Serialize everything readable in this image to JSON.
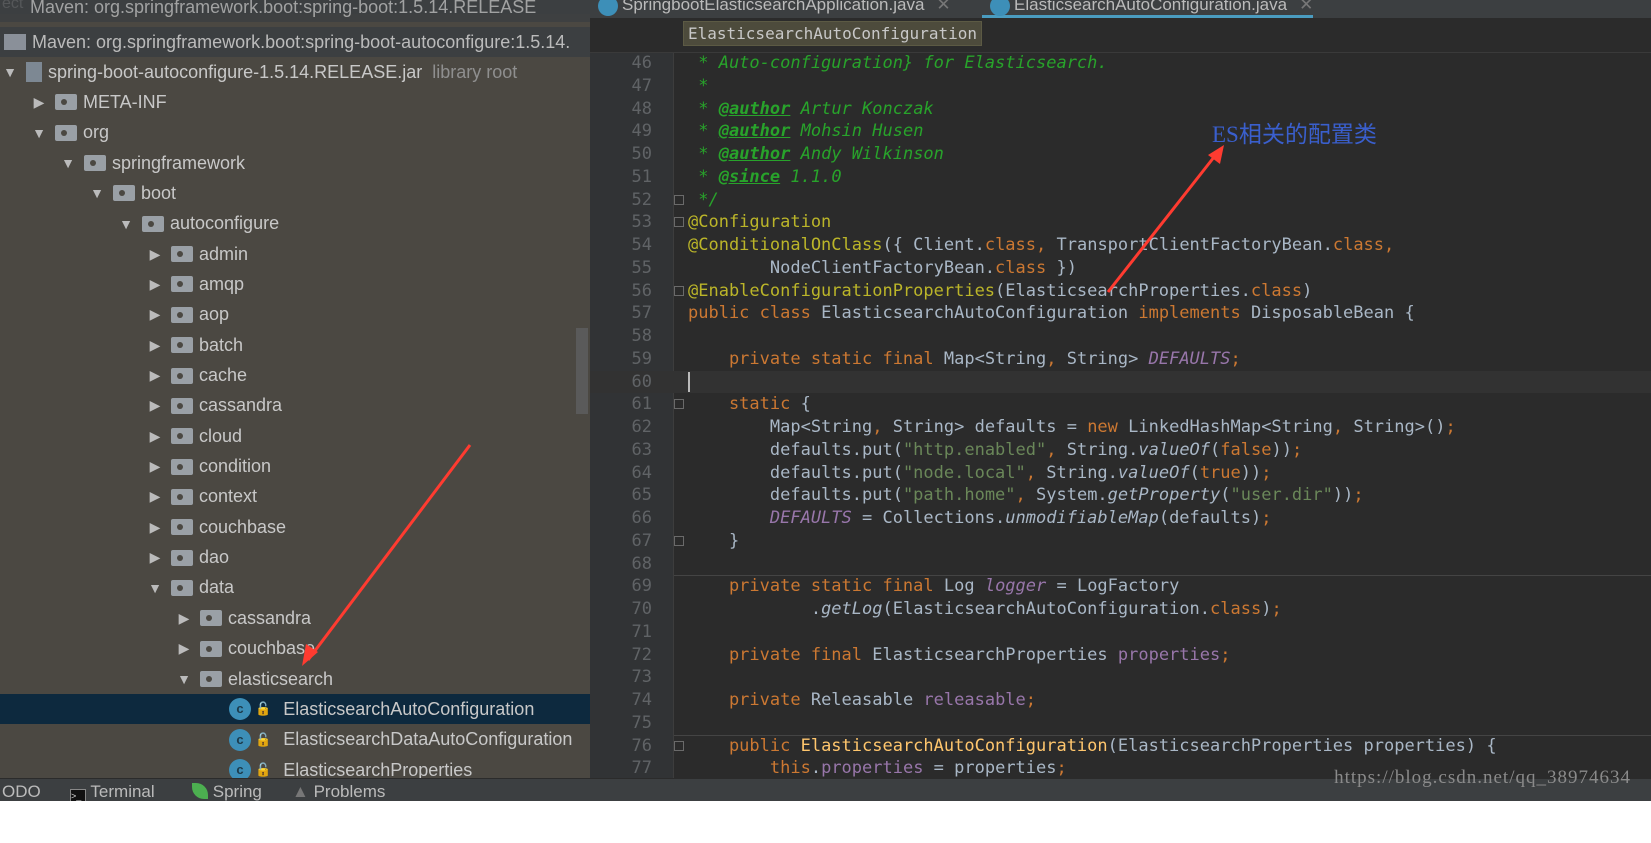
{
  "project_panel": {
    "header_label": "ect",
    "row_prev": "Maven: org.springframework.boot:spring-boot:1.5.14.RELEASE",
    "row_maven": "Maven: org.springframework.boot:spring-boot-autoconfigure:1.5.14.",
    "tree": [
      {
        "label": "spring-boot-autoconfigure-1.5.14.RELEASE.jar",
        "extra": "library root",
        "level": 0,
        "state": "open",
        "kind": "jar"
      },
      {
        "label": "META-INF",
        "level": 1,
        "state": "closed",
        "kind": "folder"
      },
      {
        "label": "org",
        "level": 1,
        "state": "open",
        "kind": "folder"
      },
      {
        "label": "springframework",
        "level": 2,
        "state": "open",
        "kind": "folder"
      },
      {
        "label": "boot",
        "level": 3,
        "state": "open",
        "kind": "folder"
      },
      {
        "label": "autoconfigure",
        "level": 4,
        "state": "open",
        "kind": "folder"
      },
      {
        "label": "admin",
        "level": 5,
        "state": "closed",
        "kind": "folder"
      },
      {
        "label": "amqp",
        "level": 5,
        "state": "closed",
        "kind": "folder"
      },
      {
        "label": "aop",
        "level": 5,
        "state": "closed",
        "kind": "folder"
      },
      {
        "label": "batch",
        "level": 5,
        "state": "closed",
        "kind": "folder"
      },
      {
        "label": "cache",
        "level": 5,
        "state": "closed",
        "kind": "folder"
      },
      {
        "label": "cassandra",
        "level": 5,
        "state": "closed",
        "kind": "folder"
      },
      {
        "label": "cloud",
        "level": 5,
        "state": "closed",
        "kind": "folder"
      },
      {
        "label": "condition",
        "level": 5,
        "state": "closed",
        "kind": "folder"
      },
      {
        "label": "context",
        "level": 5,
        "state": "closed",
        "kind": "folder"
      },
      {
        "label": "couchbase",
        "level": 5,
        "state": "closed",
        "kind": "folder"
      },
      {
        "label": "dao",
        "level": 5,
        "state": "closed",
        "kind": "folder"
      },
      {
        "label": "data",
        "level": 5,
        "state": "open",
        "kind": "folder"
      },
      {
        "label": "cassandra",
        "level": 6,
        "state": "closed",
        "kind": "folder"
      },
      {
        "label": "couchbase",
        "level": 6,
        "state": "closed",
        "kind": "folder"
      },
      {
        "label": "elasticsearch",
        "level": 6,
        "state": "open",
        "kind": "folder"
      },
      {
        "label": "ElasticsearchAutoConfiguration",
        "level": 7,
        "state": "leaf",
        "kind": "class",
        "selected": true
      },
      {
        "label": "ElasticsearchDataAutoConfiguration",
        "level": 7,
        "state": "leaf",
        "kind": "class"
      },
      {
        "label": "ElasticsearchProperties",
        "level": 7,
        "state": "leaf",
        "kind": "class"
      }
    ]
  },
  "tabs": [
    {
      "label": "SpringbootElasticsearchApplication.java",
      "active": false
    },
    {
      "label": "ElasticsearchAutoConfiguration.java",
      "active": true
    }
  ],
  "breadcrumb": "ElasticsearchAutoConfiguration",
  "code": [
    {
      "n": "46",
      "t": [
        [
          "cm",
          " * Auto-configuration} for Elasticsearch."
        ]
      ]
    },
    {
      "n": "47",
      "t": [
        [
          "cm",
          " *"
        ]
      ]
    },
    {
      "n": "48",
      "t": [
        [
          "cm",
          " * "
        ],
        [
          "tg",
          "@author"
        ],
        [
          "cm",
          " Artur Konczak"
        ]
      ]
    },
    {
      "n": "49",
      "t": [
        [
          "cm",
          " * "
        ],
        [
          "tg",
          "@author"
        ],
        [
          "cm",
          " Mohsin Husen"
        ]
      ]
    },
    {
      "n": "50",
      "t": [
        [
          "cm",
          " * "
        ],
        [
          "tg",
          "@author"
        ],
        [
          "cm",
          " Andy Wilkinson"
        ]
      ]
    },
    {
      "n": "51",
      "t": [
        [
          "cm",
          " * "
        ],
        [
          "tg",
          "@since"
        ],
        [
          "cm",
          " 1.1.0"
        ]
      ]
    },
    {
      "n": "52",
      "t": [
        [
          "cm",
          " */"
        ]
      ]
    },
    {
      "n": "53",
      "t": [
        [
          "a",
          "@Configuration"
        ]
      ]
    },
    {
      "n": "54",
      "t": [
        [
          "a",
          "@ConditionalOnClass"
        ],
        [
          "",
          "({ Client."
        ],
        [
          "k",
          "class"
        ],
        [
          "k",
          ", "
        ],
        [
          "",
          "TransportClientFactoryBean."
        ],
        [
          "k",
          "class"
        ],
        [
          "k",
          ","
        ]
      ]
    },
    {
      "n": "55",
      "t": [
        [
          "",
          "        NodeClientFactoryBean."
        ],
        [
          "k",
          "class"
        ],
        [
          "",
          " })"
        ]
      ]
    },
    {
      "n": "56",
      "t": [
        [
          "a",
          "@EnableConfigurationProperties"
        ],
        [
          "",
          "(ElasticsearchProperties."
        ],
        [
          "k",
          "class"
        ],
        [
          "",
          ")"
        ]
      ]
    },
    {
      "n": "57",
      "t": [
        [
          "k",
          "public class "
        ],
        [
          "",
          "ElasticsearchAutoConfiguration "
        ],
        [
          "k",
          "implements "
        ],
        [
          "",
          "DisposableBean {"
        ]
      ]
    },
    {
      "n": "58",
      "t": []
    },
    {
      "n": "59",
      "t": [
        [
          "k",
          "    private static final "
        ],
        [
          "",
          "Map<String"
        ],
        [
          "k",
          ", "
        ],
        [
          "",
          "String> "
        ],
        [
          "st",
          "DEFAULTS"
        ],
        [
          "k",
          ";"
        ]
      ]
    },
    {
      "n": "60",
      "t": []
    },
    {
      "n": "61",
      "t": [
        [
          "k",
          "    static "
        ],
        [
          "",
          "{"
        ]
      ]
    },
    {
      "n": "62",
      "t": [
        [
          "",
          "        Map<String"
        ],
        [
          "k",
          ", "
        ],
        [
          "",
          "String> defaults = "
        ],
        [
          "k",
          "new "
        ],
        [
          "",
          "LinkedHashMap<String"
        ],
        [
          "k",
          ", "
        ],
        [
          "",
          "String>()"
        ],
        [
          "k",
          ";"
        ]
      ]
    },
    {
      "n": "63",
      "t": [
        [
          "",
          "        defaults.put("
        ],
        [
          "s",
          "\"http.enabled\""
        ],
        [
          "k",
          ", "
        ],
        [
          "",
          "String."
        ],
        [
          "i",
          "valueOf"
        ],
        [
          "",
          "("
        ],
        [
          "k",
          "false"
        ],
        [
          "",
          "))"
        ],
        [
          "k",
          ";"
        ]
      ]
    },
    {
      "n": "64",
      "t": [
        [
          "",
          "        defaults.put("
        ],
        [
          "s",
          "\"node.local\""
        ],
        [
          "k",
          ", "
        ],
        [
          "",
          "String."
        ],
        [
          "i",
          "valueOf"
        ],
        [
          "",
          "("
        ],
        [
          "k",
          "true"
        ],
        [
          "",
          "))"
        ],
        [
          "k",
          ";"
        ]
      ]
    },
    {
      "n": "65",
      "t": [
        [
          "",
          "        defaults.put("
        ],
        [
          "s",
          "\"path.home\""
        ],
        [
          "k",
          ", "
        ],
        [
          "",
          "System."
        ],
        [
          "i",
          "getProperty"
        ],
        [
          "",
          "("
        ],
        [
          "s",
          "\"user.dir\""
        ],
        [
          "",
          "))"
        ],
        [
          "k",
          ";"
        ]
      ]
    },
    {
      "n": "66",
      "t": [
        [
          "st",
          "        DEFAULTS"
        ],
        [
          "",
          " = Collections."
        ],
        [
          "i",
          "unmodifiableMap"
        ],
        [
          "",
          "(defaults)"
        ],
        [
          "k",
          ";"
        ]
      ]
    },
    {
      "n": "67",
      "t": [
        [
          "",
          "    }"
        ]
      ]
    },
    {
      "n": "68",
      "t": []
    },
    {
      "n": "69",
      "t": [
        [
          "k",
          "    private static final "
        ],
        [
          "",
          "Log "
        ],
        [
          "st",
          "logger"
        ],
        [
          "",
          " = LogFactory"
        ]
      ]
    },
    {
      "n": "70",
      "t": [
        [
          "",
          "            ."
        ],
        [
          "i",
          "getLog"
        ],
        [
          "",
          "(ElasticsearchAutoConfiguration."
        ],
        [
          "k",
          "class"
        ],
        [
          "",
          ")"
        ],
        [
          "k",
          ";"
        ]
      ]
    },
    {
      "n": "71",
      "t": []
    },
    {
      "n": "72",
      "t": [
        [
          "k",
          "    private final "
        ],
        [
          "",
          "ElasticsearchProperties "
        ],
        [
          "p",
          "properties"
        ],
        [
          "k",
          ";"
        ]
      ]
    },
    {
      "n": "73",
      "t": []
    },
    {
      "n": "74",
      "t": [
        [
          "k",
          "    private "
        ],
        [
          "",
          "Releasable "
        ],
        [
          "p",
          "releasable"
        ],
        [
          "k",
          ";"
        ]
      ]
    },
    {
      "n": "75",
      "t": []
    },
    {
      "n": "76",
      "t": [
        [
          "k",
          "    public "
        ],
        [
          "f",
          "ElasticsearchAutoConfiguration"
        ],
        [
          "",
          "(ElasticsearchProperties properties) {"
        ]
      ]
    },
    {
      "n": "77",
      "t": [
        [
          "k",
          "        this"
        ],
        [
          "",
          "."
        ],
        [
          "p",
          "properties"
        ],
        [
          "",
          " = properties"
        ],
        [
          "k",
          ";"
        ]
      ]
    }
  ],
  "bottom_bar": {
    "todo": "ODO",
    "terminal": "Terminal",
    "spring": "Spring",
    "problems": "Problems"
  },
  "annotation": "ES相关的配置类",
  "watermark": "https://blog.csdn.net/qq_38974634"
}
